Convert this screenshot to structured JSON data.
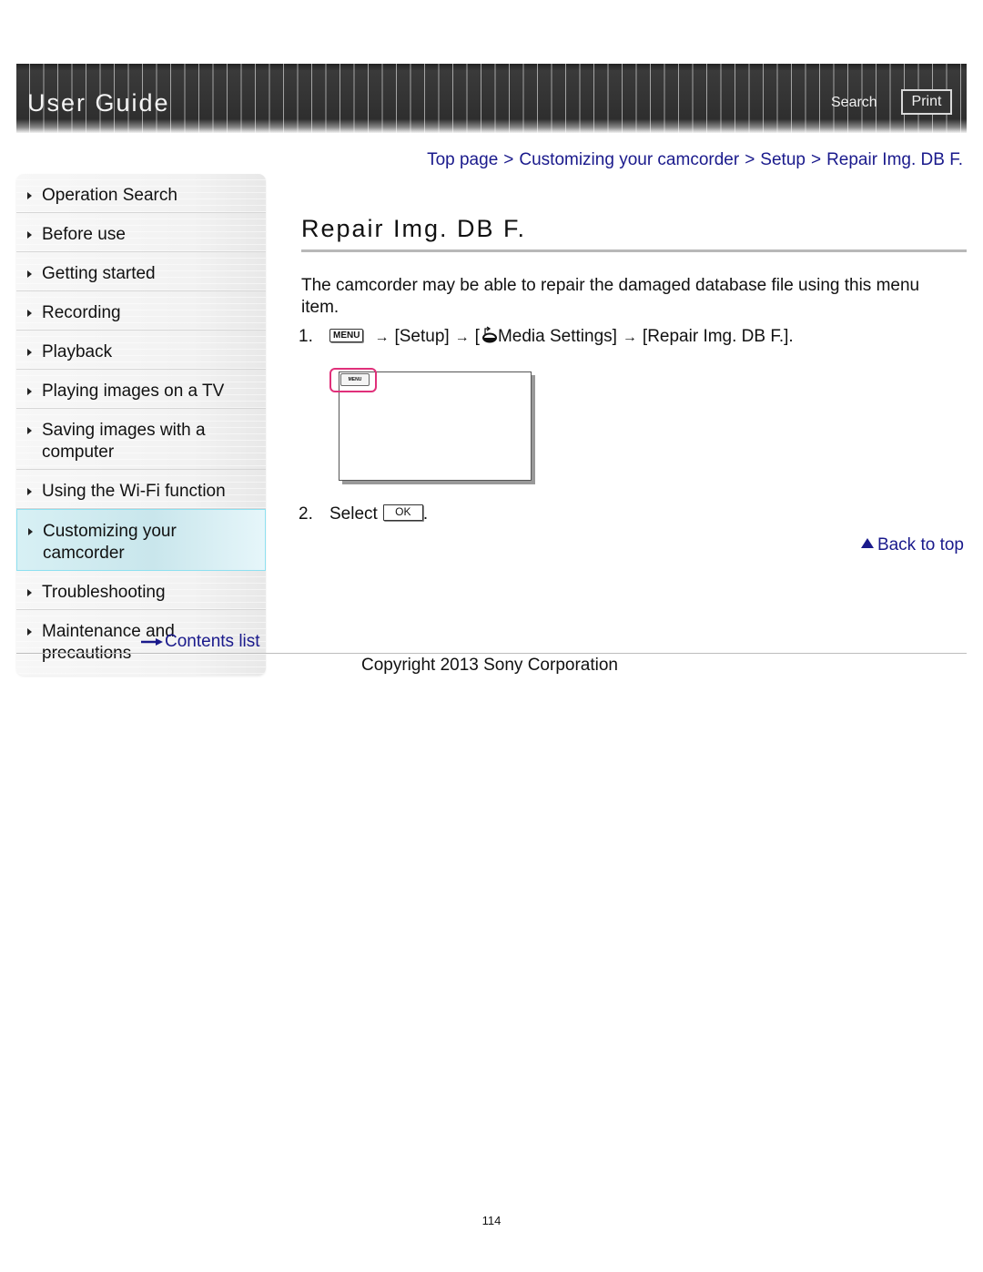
{
  "header": {
    "title": "User Guide",
    "search_label": "Search",
    "print_label": "Print"
  },
  "breadcrumb": {
    "items": [
      "Top page",
      "Customizing your camcorder",
      "Setup",
      "Repair Img. DB F."
    ],
    "separator": ">"
  },
  "sidebar": {
    "items": [
      {
        "label": "Operation Search",
        "active": false
      },
      {
        "label": "Before use",
        "active": false
      },
      {
        "label": "Getting started",
        "active": false
      },
      {
        "label": "Recording",
        "active": false
      },
      {
        "label": "Playback",
        "active": false
      },
      {
        "label": "Playing images on a TV",
        "active": false
      },
      {
        "label": "Saving images with a computer",
        "active": false
      },
      {
        "label": "Using the Wi-Fi function",
        "active": false
      },
      {
        "label": "Customizing your camcorder",
        "active": true
      },
      {
        "label": "Troubleshooting",
        "active": false
      },
      {
        "label": "Maintenance and precautions",
        "active": false
      }
    ],
    "contents_link": "Contents list"
  },
  "main": {
    "title": "Repair Img. DB F.",
    "intro": "The camcorder may be able to repair the damaged database file using this menu item.",
    "steps": [
      {
        "number": "1.",
        "menu_key": "MENU",
        "arrow": "→",
        "setup": "[Setup]",
        "media_open": "[",
        "media_icon": "media-settings-icon",
        "media_label": "Media Settings]",
        "target": "[Repair Img. DB F.]."
      },
      {
        "number": "2.",
        "text": "Select",
        "ok_key": "OK",
        "end": "."
      }
    ],
    "illustration": {
      "menu_button_label": "MENU",
      "highlight_color": "#e0307a"
    },
    "back_to_top": "Back to top"
  },
  "footer": {
    "copyright": "Copyright 2013 Sony Corporation",
    "page_number": "114"
  },
  "colors": {
    "link": "#1a1a8c",
    "active_nav": "#d7f0f4",
    "active_nav_border": "#8ee0f0"
  }
}
